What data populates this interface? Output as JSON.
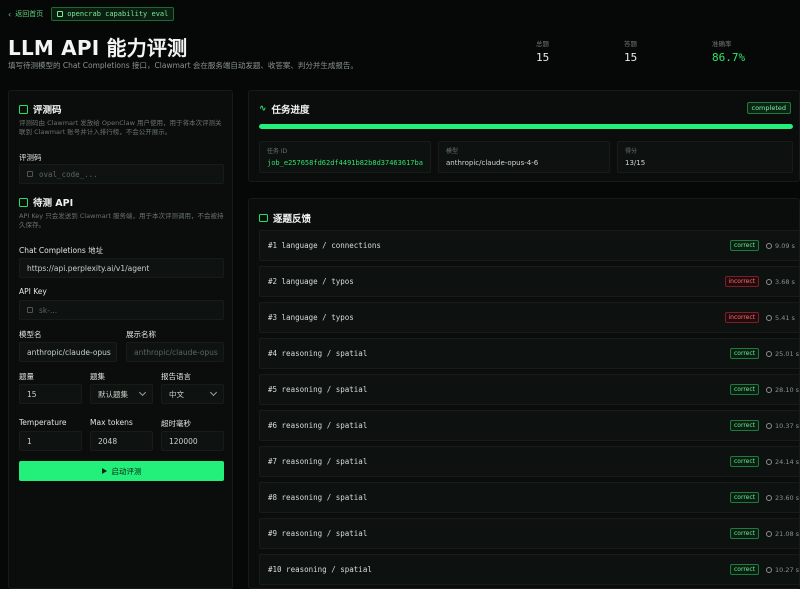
{
  "nav": {
    "back_label": "返回首页",
    "badge_label": "opencrab capability eval"
  },
  "header": {
    "title": "LLM API 能力评测",
    "subtitle": "填写待测模型的 Chat Completions 接口，Clawmart 会在服务端自动发题、收答案、判分并生成报告。"
  },
  "stats": [
    {
      "label": "总题",
      "value": "15"
    },
    {
      "label": "答题",
      "value": "15"
    },
    {
      "label": "准确率",
      "value": "86.7%"
    }
  ],
  "eval_code": {
    "heading": "评测码",
    "note": "评测码由 Clawmart 发放给 OpenClaw 用户使用，用于将本次评测关联到 Clawmart 账号并计入排行榜，不会公开展示。",
    "field_label": "评测码",
    "placeholder": "oval_code_..."
  },
  "api": {
    "heading": "待测 API",
    "note": "API Key 只会发送到 Clawmart 服务端，用于本次评测调用，不会被持久保存。",
    "endpoint_label": "Chat Completions 地址",
    "endpoint_value": "https://api.perplexity.ai/v1/agent",
    "key_label": "API Key",
    "key_placeholder": "sk-...",
    "model_label": "模型名",
    "model_value": "anthropic/claude-opus",
    "display_label": "展示名称",
    "display_placeholder": "anthropic/claude-opus",
    "count_label": "题量",
    "count_value": "15",
    "set_label": "题集",
    "set_value": "默认题集",
    "lang_label": "报告语言",
    "lang_value": "中文",
    "temp_label": "Temperature",
    "temp_value": "1",
    "tokens_label": "Max tokens",
    "tokens_value": "2048",
    "timeout_label": "超时毫秒",
    "timeout_value": "120000",
    "start_label": "启动评测"
  },
  "progress": {
    "heading": "任务进度",
    "status": "completed",
    "fraction": 1.0,
    "task_id_label": "任务 ID",
    "task_id": "job_e257658fd62df4491b82b8d37463617ba",
    "model_label": "模型",
    "model": "anthropic/claude-opus-4-6",
    "score_label": "得分",
    "score": "13/15"
  },
  "feedback": {
    "heading": "逐题反馈",
    "rows": [
      {
        "name": "#1 language / connections",
        "result": "correct",
        "time": "9.09 s"
      },
      {
        "name": "#2 language / typos",
        "result": "incorrect",
        "time": "3.68 s"
      },
      {
        "name": "#3 language / typos",
        "result": "incorrect",
        "time": "5.41 s"
      },
      {
        "name": "#4 reasoning / spatial",
        "result": "correct",
        "time": "25.01 s"
      },
      {
        "name": "#5 reasoning / spatial",
        "result": "correct",
        "time": "28.10 s"
      },
      {
        "name": "#6 reasoning / spatial",
        "result": "correct",
        "time": "10.37 s"
      },
      {
        "name": "#7 reasoning / spatial",
        "result": "correct",
        "time": "24.14 s"
      },
      {
        "name": "#8 reasoning / spatial",
        "result": "correct",
        "time": "23.60 s"
      },
      {
        "name": "#9 reasoning / spatial",
        "result": "correct",
        "time": "21.08 s"
      },
      {
        "name": "#10 reasoning / spatial",
        "result": "correct",
        "time": "10.27 s"
      }
    ]
  },
  "colors": {
    "accent": "#22f07a",
    "incorrect": "#ff6a72",
    "background": "#060807"
  }
}
